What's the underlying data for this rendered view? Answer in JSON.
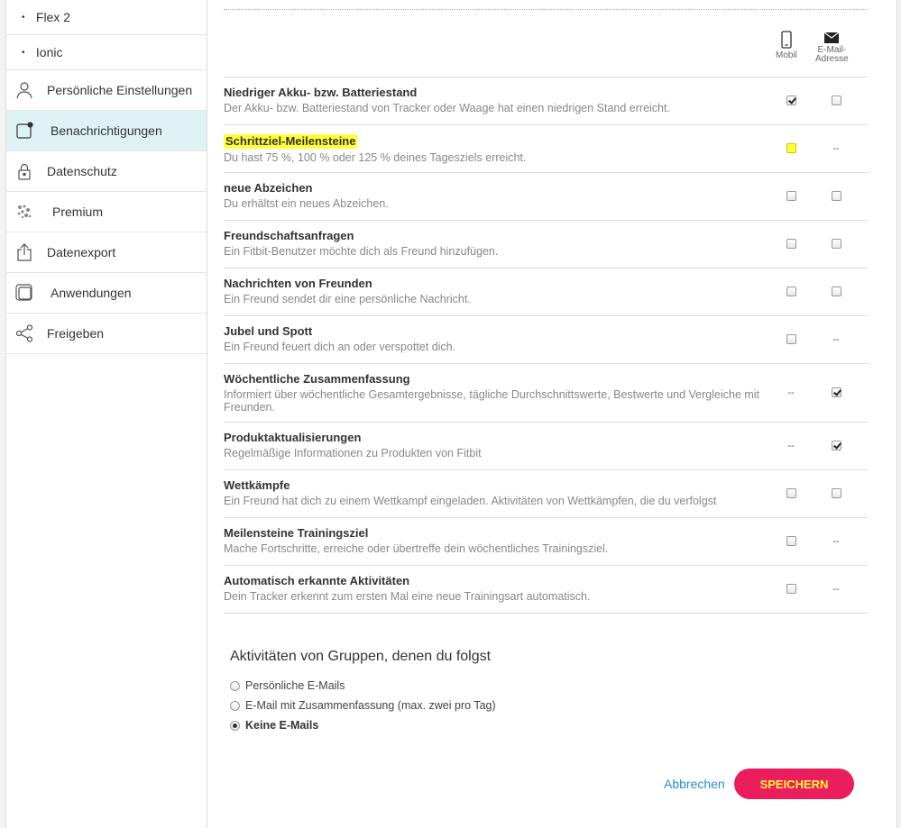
{
  "sidebar": {
    "devices": [
      {
        "label": "Flex 2"
      },
      {
        "label": "Ionic"
      }
    ],
    "items": [
      {
        "label": "Persönliche Einstellungen",
        "icon": "user-icon",
        "active": false
      },
      {
        "label": "Benachrichtigungen",
        "icon": "notification-icon",
        "active": true
      },
      {
        "label": "Datenschutz",
        "icon": "lock-icon",
        "active": false
      },
      {
        "label": "Premium",
        "icon": "premium-icon",
        "active": false
      },
      {
        "label": "Datenexport",
        "icon": "export-icon",
        "active": false
      },
      {
        "label": "Anwendungen",
        "icon": "apps-icon",
        "active": false
      },
      {
        "label": "Freigeben",
        "icon": "share-icon",
        "active": false
      }
    ]
  },
  "columns": {
    "mobile": "Mobil",
    "email_line1": "E-Mail-",
    "email_line2": "Adresse"
  },
  "notifications": [
    {
      "title": "Niedriger Akku- bzw. Batteriestand",
      "desc": "Der Akku- bzw. Batteriestand von Tracker oder Waage hat einen niedrigen Stand erreicht.",
      "mobile": "checked",
      "email": "unchecked",
      "highlight": false
    },
    {
      "title": "Schrittziel-Meilensteine",
      "desc": "Du hast 75 %, 100 % oder 125 % deines Tagesziels erreicht.",
      "mobile": "highlight",
      "email": "--",
      "highlight": true
    },
    {
      "title": "neue Abzeichen",
      "desc": "Du erhältst ein neues Abzeichen.",
      "mobile": "unchecked",
      "email": "unchecked",
      "highlight": false
    },
    {
      "title": "Freundschaftsanfragen",
      "desc": "Ein Fitbit-Benutzer möchte dich als Freund hinzufügen.",
      "mobile": "unchecked",
      "email": "unchecked",
      "highlight": false
    },
    {
      "title": "Nachrichten von Freunden",
      "desc": "Ein Freund sendet dir eine persönliche Nachricht.",
      "mobile": "unchecked",
      "email": "unchecked",
      "highlight": false
    },
    {
      "title": "Jubel und Spott",
      "desc": "Ein Freund feuert dich an oder verspottet dich.",
      "mobile": "unchecked",
      "email": "--",
      "highlight": false
    },
    {
      "title": "Wöchentliche Zusammenfassung",
      "desc": "Informiert über wöchentliche Gesamtergebnisse, tägliche Durchschnittswerte, Bestwerte und Vergleiche mit Freunden.",
      "mobile": "--",
      "email": "checked",
      "highlight": false
    },
    {
      "title": "Produktaktualisierungen",
      "desc": "Regelmäßige Informationen zu Produkten von Fitbit",
      "mobile": "--",
      "email": "checked",
      "highlight": false
    },
    {
      "title": "Wettkämpfe",
      "desc": "Ein Freund hat dich zu einem Wettkampf eingeladen. Aktivitäten von Wettkämpfen, die du verfolgst",
      "mobile": "unchecked",
      "email": "unchecked",
      "highlight": false
    },
    {
      "title": "Meilensteine Trainingsziel",
      "desc": "Mache Fortschritte, erreiche oder übertreffe dein wöchentliches Trainingsziel.",
      "mobile": "unchecked",
      "email": "--",
      "highlight": false
    },
    {
      "title": "Automatisch erkannte Aktivitäten",
      "desc": "Dein Tracker erkennt zum ersten Mal eine neue Trainingsart automatisch.",
      "mobile": "unchecked",
      "email": "--",
      "highlight": false
    }
  ],
  "groups": {
    "heading": "Aktivitäten von Gruppen, denen du folgst",
    "options": [
      {
        "label": "Persönliche E-Mails",
        "selected": false
      },
      {
        "label": "E-Mail mit Zusammenfassung (max. zwei pro Tag)",
        "selected": false
      },
      {
        "label": "Keine E-Mails",
        "selected": true
      }
    ]
  },
  "actions": {
    "cancel": "Abbrechen",
    "save": "SPEICHERN"
  },
  "colors": {
    "active_bg": "#dff2f3",
    "save_bg": "#ea1d5d",
    "highlight": "#ffff3a",
    "link": "#2a8fd4"
  }
}
